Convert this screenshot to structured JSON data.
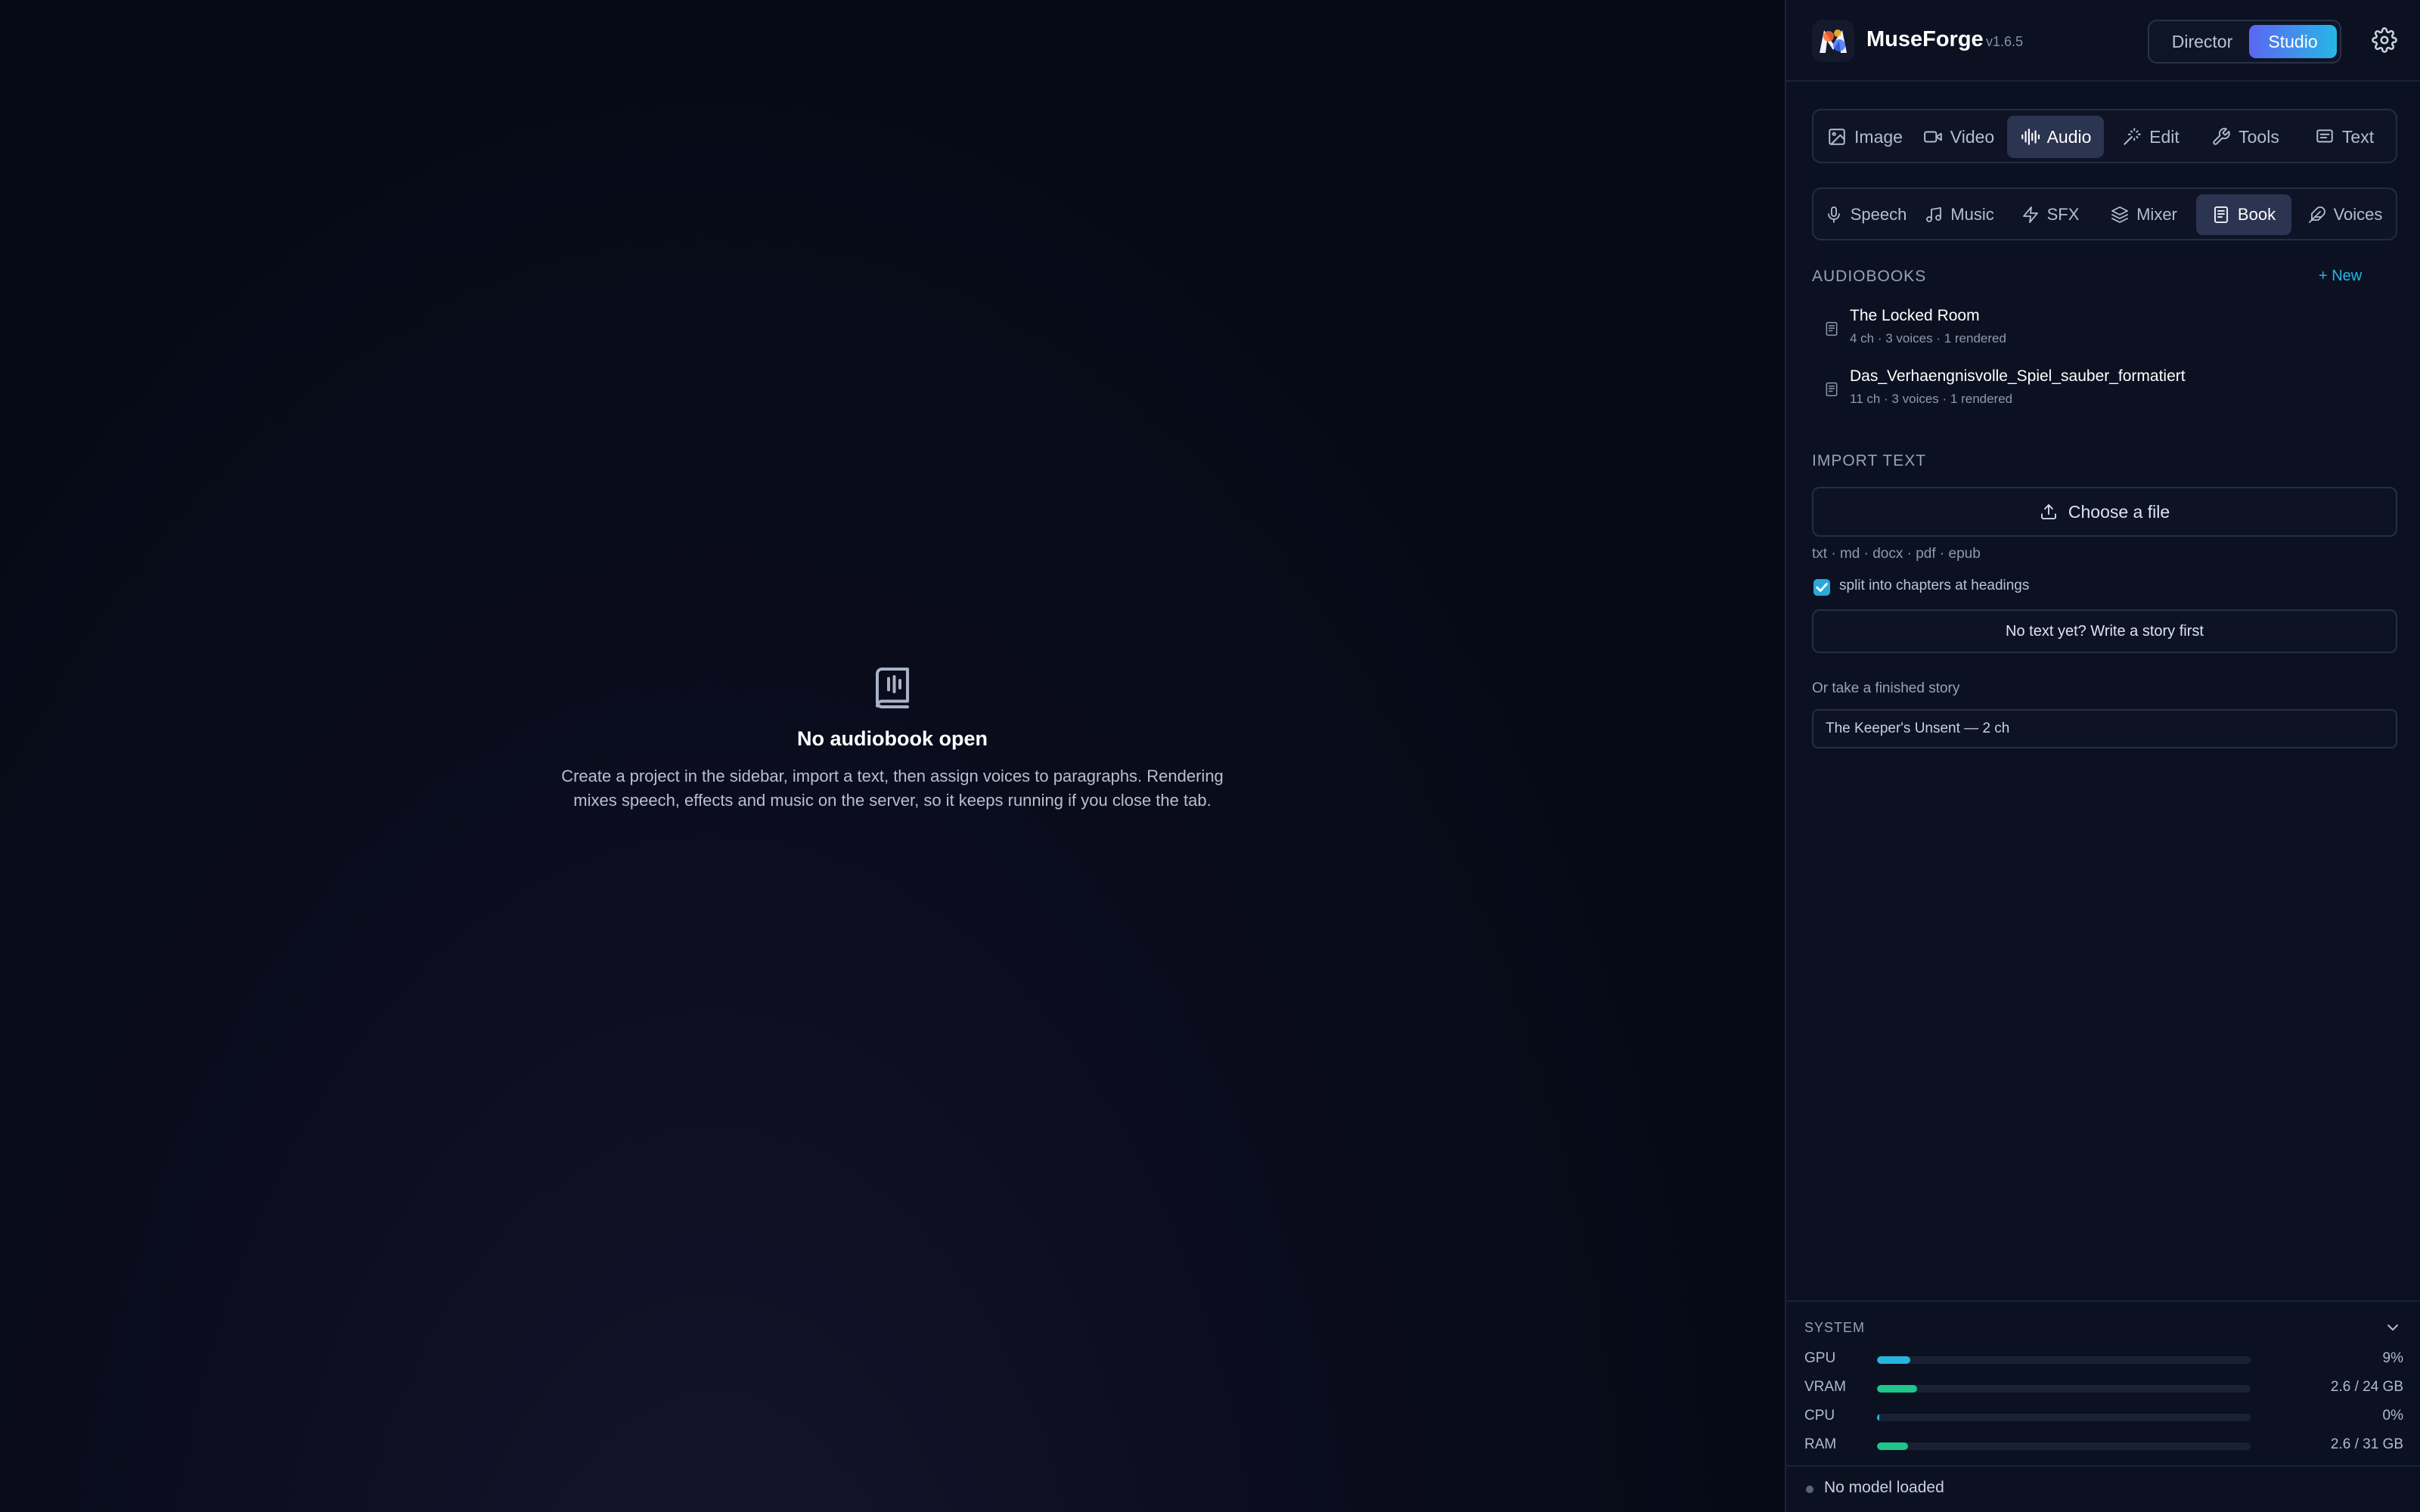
{
  "empty_state": {
    "title": "No audiobook open",
    "description": "Create a project in the sidebar, import a text, then assign voices to paragraphs. Rendering mixes speech, effects and music on the server, so it keeps running if you close the tab."
  },
  "header": {
    "app_name": "MuseForge",
    "version": "v1.6.5",
    "modes": [
      "Director",
      "Studio"
    ],
    "active_mode": "Studio"
  },
  "primary_tabs": [
    {
      "label": "Image",
      "icon": "image-icon"
    },
    {
      "label": "Video",
      "icon": "video-icon"
    },
    {
      "label": "Audio",
      "icon": "waveform-icon",
      "active": true
    },
    {
      "label": "Edit",
      "icon": "magic-wand-icon"
    },
    {
      "label": "Tools",
      "icon": "wrench-icon"
    },
    {
      "label": "Text",
      "icon": "message-icon"
    }
  ],
  "audio_tabs": [
    {
      "label": "Speech",
      "icon": "microphone-icon"
    },
    {
      "label": "Music",
      "icon": "music-note-icon"
    },
    {
      "label": "SFX",
      "icon": "lightning-icon"
    },
    {
      "label": "Mixer",
      "icon": "layers-icon"
    },
    {
      "label": "Book",
      "icon": "book-icon",
      "active": true
    },
    {
      "label": "Voices",
      "icon": "feather-icon"
    }
  ],
  "audiobooks": {
    "section_label": "AUDIOBOOKS",
    "new_label": "+ New",
    "items": [
      {
        "title": "The Locked Room",
        "meta": "4 ch · 3 voices · 1 rendered"
      },
      {
        "title": "Das_Verhaengnisvolle_Spiel_sauber_formatiert",
        "meta": "11 ch · 3 voices · 1 rendered"
      }
    ]
  },
  "import": {
    "section_label": "IMPORT TEXT",
    "choose_file_label": "Choose a file",
    "formats": "txt · md · docx · pdf · epub",
    "split_label": "split into chapters at headings",
    "split_checked": true,
    "write_story_label": "No text yet? Write a story first",
    "finished_story_label": "Or take a finished story",
    "selected_story": "The Keeper's Unsent — 2 ch"
  },
  "system": {
    "title": "SYSTEM",
    "metrics": [
      {
        "label": "GPU",
        "value": "9%",
        "fraction": 0.09,
        "color": "#26b5e0"
      },
      {
        "label": "VRAM",
        "value": "2.6 / 24 GB",
        "fraction": 0.108,
        "color": "#1fc58a"
      },
      {
        "label": "CPU",
        "value": "0%",
        "fraction": 0.0,
        "color": "#26b5e0"
      },
      {
        "label": "RAM",
        "value": "2.6 / 31 GB",
        "fraction": 0.084,
        "color": "#1fc58a"
      }
    ],
    "model_status": "No model loaded"
  }
}
